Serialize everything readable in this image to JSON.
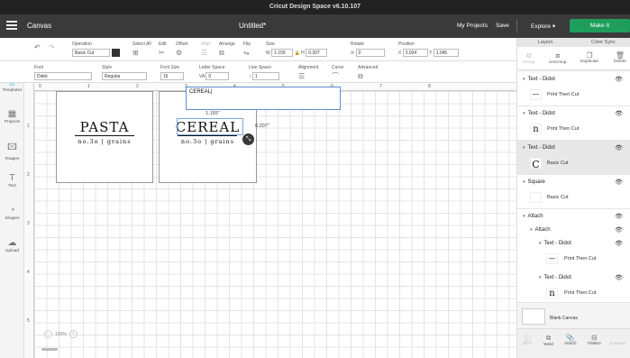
{
  "window": {
    "title": "Cricut Design Space  v6.10.107"
  },
  "topbar": {
    "section": "Canvas",
    "document_title": "Untitled*",
    "my_projects": "My Projects",
    "save": "Save",
    "explore": "Explore",
    "make_it": "Make It",
    "make_it_color": "#1f9e5b"
  },
  "toolbar": {
    "operation_label": "Operation",
    "operation_value": "Basic Cut",
    "select_all": "Select All",
    "edit": "Edit",
    "offset": "Offset",
    "align": "Align",
    "arrange": "Arrange",
    "flip": "Flip",
    "size": "Size",
    "size_w_label": "W",
    "size_w": "1.155",
    "size_h_label": "H",
    "size_h": "0.207",
    "rotate": "Rotate",
    "rotate_value": "0",
    "position": "Position",
    "pos_x_label": "X",
    "pos_x": "3.034",
    "pos_y_label": "Y",
    "pos_y": "1.045"
  },
  "text_toolbar": {
    "font_label": "Font",
    "font_value": "Didot",
    "style_label": "Style",
    "style_value": "Regular",
    "font_size_label": "Font Size",
    "font_size_value": "16",
    "letter_space_label": "Letter Space",
    "letter_space_prefix": "VA",
    "letter_space_value": "0",
    "line_space_label": "Line Space",
    "line_space_value": "1",
    "alignment_label": "Alignment",
    "curve_label": "Curve",
    "advanced_label": "Advanced"
  },
  "sidebar": {
    "items": [
      {
        "label": "New",
        "icon": "plus-icon"
      },
      {
        "label": "Templates",
        "icon": "shirt-icon"
      },
      {
        "label": "Projects",
        "icon": "projects-icon"
      },
      {
        "label": "Images",
        "icon": "image-icon"
      },
      {
        "label": "Text",
        "icon": "text-icon"
      },
      {
        "label": "Shapes",
        "icon": "shapes-icon"
      },
      {
        "label": "Upload",
        "icon": "upload-icon"
      }
    ]
  },
  "rulers": {
    "top": [
      "0",
      "1",
      "2",
      "3",
      "4",
      "5",
      "6",
      "7",
      "8"
    ],
    "left": [
      "1",
      "2",
      "3",
      "4",
      "5"
    ]
  },
  "canvas": {
    "card1": {
      "title": "PASTA",
      "subtitle": "no.3o | grains"
    },
    "card2": {
      "title": "CEREAL",
      "subtitle": "no.3o | grains"
    },
    "edit_text": "CEREAL",
    "width_label": "1.155\"",
    "height_label": "0.207\"",
    "zoom": "100%"
  },
  "layers_panel": {
    "tab_layers": "Layers",
    "tab_color_sync": "Color Sync",
    "tools": [
      "Group",
      "UnGroup",
      "Duplicate",
      "Delete"
    ],
    "groups": [
      {
        "name": "Text - Didot",
        "sub": "Print Then Cut",
        "thumb": "—"
      },
      {
        "name": "Text - Didot",
        "sub": "Print Then Cut",
        "thumb": "n"
      },
      {
        "name": "Text - Didot",
        "sub": "Basic Cut",
        "thumb": "C"
      },
      {
        "name": "Square",
        "sub": "Basic Cut",
        "thumb": ""
      },
      {
        "name": "Attach"
      },
      {
        "name": "Attach"
      },
      {
        "name": "Text - Didot",
        "sub": "Print Then Cut",
        "thumb": "—"
      },
      {
        "name": "Text - Didot",
        "sub": "Print Then Cut",
        "thumb": "n"
      }
    ],
    "blank_canvas": "Blank Canvas",
    "bottom_tools": [
      "Slice",
      "Weld",
      "Attach",
      "Flatten",
      "Contour"
    ]
  }
}
